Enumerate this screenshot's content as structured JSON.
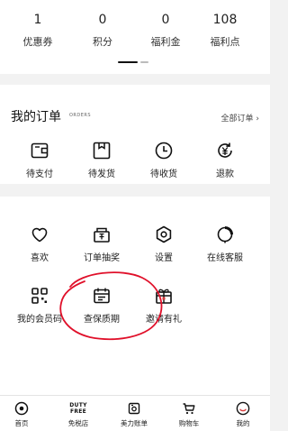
{
  "stats": [
    {
      "value": "1",
      "label": "优惠券"
    },
    {
      "value": "0",
      "label": "积分"
    },
    {
      "value": "0",
      "label": "福利金"
    },
    {
      "value": "108",
      "label": "福利点"
    }
  ],
  "orders": {
    "title": "我的订单",
    "subtitle": "ORDERS",
    "all_link": "全部订单 ›",
    "items": [
      {
        "label": "待支付",
        "icon": "wallet-icon"
      },
      {
        "label": "待发货",
        "icon": "package-icon"
      },
      {
        "label": "待收货",
        "icon": "clock-icon"
      },
      {
        "label": "退款",
        "icon": "refund-icon"
      }
    ]
  },
  "services": {
    "items": [
      {
        "label": "喜欢",
        "icon": "heart-icon"
      },
      {
        "label": "订单抽奖",
        "icon": "prize-icon"
      },
      {
        "label": "设置",
        "icon": "settings-icon"
      },
      {
        "label": "在线客服",
        "icon": "customer-service-icon"
      },
      {
        "label": "我的会员码",
        "icon": "qr-code-icon"
      },
      {
        "label": "查保质期",
        "icon": "calendar-icon"
      },
      {
        "label": "邀请有礼",
        "icon": "gift-icon"
      }
    ]
  },
  "annotation_color": "#e0102a",
  "tabbar": {
    "items": [
      {
        "label": "首页",
        "icon": "home-icon"
      },
      {
        "label": "免税店",
        "icon": "duty-free-icon",
        "icon_text": "DUTY\nFREE"
      },
      {
        "label": "美力账单",
        "icon": "bill-icon"
      },
      {
        "label": "购物车",
        "icon": "cart-icon"
      },
      {
        "label": "我的",
        "icon": "profile-icon"
      }
    ]
  }
}
